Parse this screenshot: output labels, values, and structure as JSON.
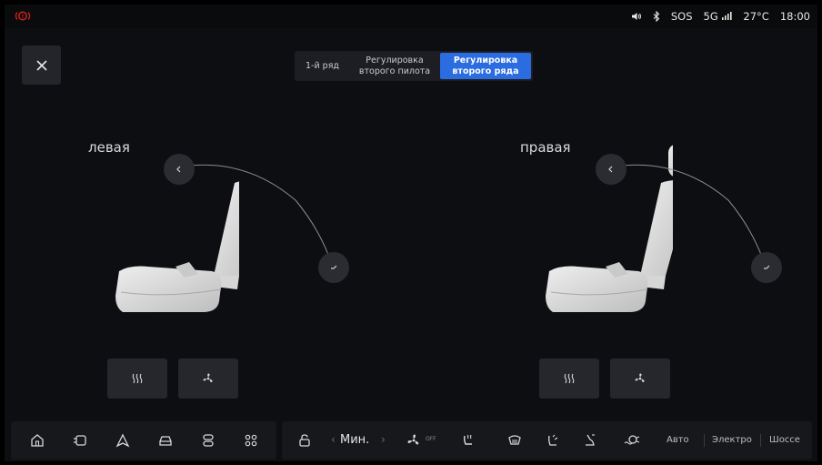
{
  "status": {
    "sos": "SOS",
    "network": "5G",
    "temperature": "27°C",
    "time": "18:00"
  },
  "tabs": [
    {
      "label": "1-й ряд",
      "active": false
    },
    {
      "label": "Регулировка\nвторого пилота",
      "active": false
    },
    {
      "label": "Регулировка\nвторого ряда",
      "active": true
    }
  ],
  "seats": {
    "left": {
      "label": "левая"
    },
    "right": {
      "label": "правая"
    }
  },
  "climate": {
    "fan_level": "Мин.",
    "fan_off": "OFF"
  },
  "drive_modes": [
    "Авто",
    "Электро",
    "Шоссе"
  ],
  "colors": {
    "accent": "#2b6ce0",
    "brake_warning": "#d32020"
  }
}
